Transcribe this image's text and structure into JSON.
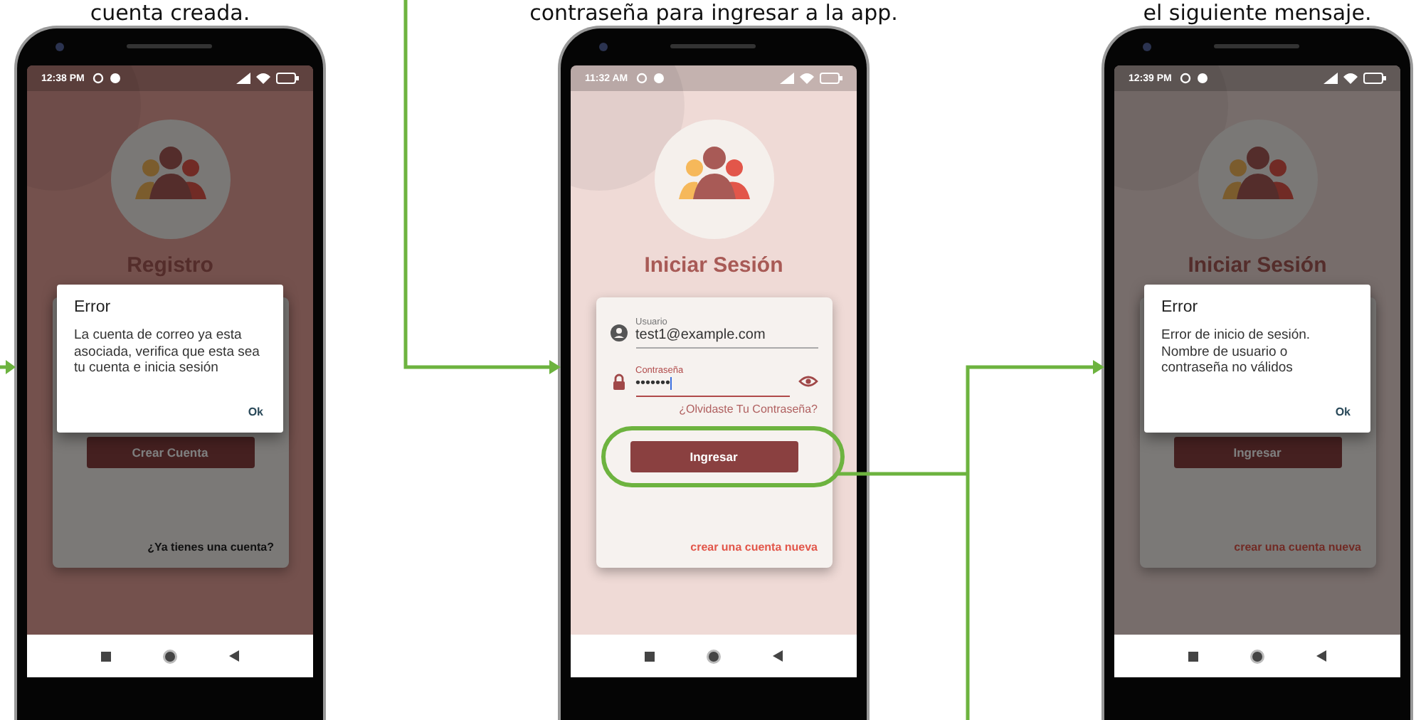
{
  "captions": [
    "cuenta creada.",
    "contraseña para ingresar a la app.",
    "el siguiente mensaje."
  ],
  "screens": [
    {
      "kind": "register",
      "dimmed": true,
      "status_time": "12:38 PM",
      "title": "Registro",
      "button": "Crear Cuenta",
      "button_highlighted": false,
      "link": {
        "text": "¿Ya tienes una cuenta?",
        "kind": "plain"
      },
      "dialog": {
        "title": "Error",
        "message": "La cuenta de correo ya esta asociada, verifica que esta sea tu cuenta e inicia sesión",
        "action": "Ok"
      }
    },
    {
      "kind": "login",
      "dimmed": false,
      "status_time": "11:32 AM",
      "title": "Iniciar Sesión",
      "fields": [
        {
          "kind": "user",
          "label": "Usuario",
          "value": "test1@example.com",
          "focused": false
        },
        {
          "kind": "password",
          "label": "Contraseña",
          "value": "•••••••",
          "focused": true
        }
      ],
      "forgot": "¿Olvidaste Tu Contraseña?",
      "button": "Ingresar",
      "button_highlighted": true,
      "link": {
        "text": "crear una cuenta nueva",
        "kind": "accent"
      }
    },
    {
      "kind": "login",
      "dimmed": true,
      "status_time": "12:39 PM",
      "title": "Iniciar Sesión",
      "button": "Ingresar",
      "button_highlighted": false,
      "link": {
        "text": "crear una cuenta nueva",
        "kind": "accent"
      },
      "dialog": {
        "title": "Error",
        "message": "Error de inicio de sesión. Nombre de usuario o contraseña no válidos",
        "action": "Ok"
      }
    }
  ]
}
